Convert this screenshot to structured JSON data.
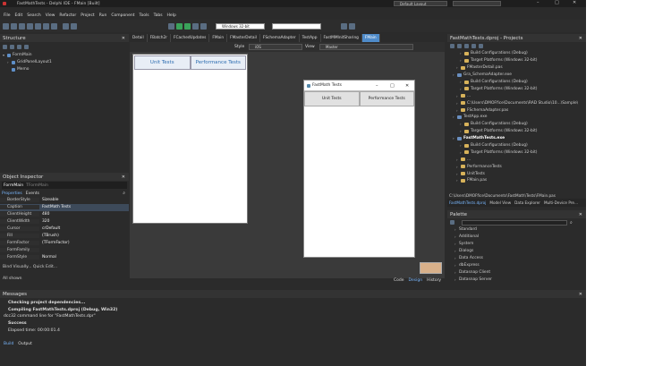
{
  "window": {
    "title": "FastMathTests - Delphi IDE - FMain [Built]",
    "layout_combo": "Default Layout"
  },
  "menu": [
    "File",
    "Edit",
    "Search",
    "View",
    "Refactor",
    "Project",
    "Run",
    "Component",
    "Tools",
    "Tabs",
    "Help"
  ],
  "toolbar": {
    "platform": "Windows 32-bit"
  },
  "structure": {
    "title": "Structure",
    "items": [
      "FormMain",
      "GridPanelLayout1",
      "Memo"
    ]
  },
  "object_inspector": {
    "title": "Object Inspector",
    "component": "FormMain",
    "component_type": "TFormMain",
    "tabs": [
      "Properties",
      "Events"
    ],
    "props": [
      {
        "k": "BorderStyle",
        "v": "Sizeable"
      },
      {
        "k": "Caption",
        "v": "FastMath Tests"
      },
      {
        "k": "ClientHeight",
        "v": "480"
      },
      {
        "k": "ClientWidth",
        "v": "320"
      },
      {
        "k": "Cursor",
        "v": "crDefault"
      },
      {
        "k": "Fill",
        "v": "(TBrush)"
      },
      {
        "k": "FormFactor",
        "v": "(TFormFactor)"
      },
      {
        "k": "FormFamily",
        "v": ""
      },
      {
        "k": "FormStyle",
        "v": "Normal"
      }
    ],
    "bind": "Bind Visually...  Quick Edit...",
    "filter": "All shown"
  },
  "editor": {
    "tabs": [
      "Detail",
      "FBatch2r",
      "FCachedUpdates",
      "FMain",
      "FMasterDetail",
      "FSchemaAdapter",
      "TestApp",
      "FastMMInitSharing",
      "FMain"
    ],
    "style_label": "Style",
    "style_value": "iOS",
    "view_label": "View",
    "view_value": "Master",
    "form_buttons": [
      "Unit Tests",
      "Performance Tests"
    ],
    "bottom_tabs": [
      "Code",
      "Design",
      "History"
    ]
  },
  "running_app": {
    "title": "FastMath Tests",
    "buttons": [
      "Unit Tests",
      "Performance Tests"
    ]
  },
  "projects": {
    "title": "FastMathTests.dproj - Projects",
    "tree": [
      "Build Configurations (Debug)",
      "Target Platforms (Windows 32-bit)",
      "FMasterDetail.pas",
      "Gra_SchemaAdapter.exe",
      "Build Configurations (Debug)",
      "Target Platforms (Windows 32-bit)",
      "...",
      "C:\\Users\\DMOFfice\\Documents\\RAD Studio\\10...\\Sample\\",
      "FSchemaAdapter.pas",
      "TestApp.exe",
      "Build Configurations (Debug)",
      "Target Platforms (Windows 32-bit)",
      "FastMathTests.exe",
      "Build Configurations (Debug)",
      "Target Platforms (Windows 32-bit)",
      "...",
      "PerformanceTests",
      "UnitTests",
      "FMain.pas"
    ],
    "path": "C:\\Users\\DMOFfice\\Documents\\FastMath\\Tests\\FMain.pas",
    "tabs": [
      "FastMathTests.dproj",
      "Model View",
      "Data Explorer",
      "Multi-Device Pre..."
    ]
  },
  "palette": {
    "title": "Palette",
    "items": [
      "Standard",
      "Additional",
      "System",
      "Dialogs",
      "Data Access",
      "dbExpress",
      "Datasnap Client",
      "Datasnap Server"
    ]
  },
  "messages": {
    "title": "Messages",
    "lines": [
      {
        "text": "Checking project dependencies...",
        "bold": true
      },
      {
        "text": "Compiling FastMathTests.dproj (Debug, Win32)",
        "bold": true
      },
      {
        "text": "dcc32 command line for \"FastMathTests.dpr\"",
        "bold": false
      },
      {
        "text": "Success",
        "bold": true
      },
      {
        "text": "Elapsed time: 00:00:01.4",
        "bold": false
      }
    ],
    "tabs": [
      "Build",
      "Output"
    ]
  }
}
